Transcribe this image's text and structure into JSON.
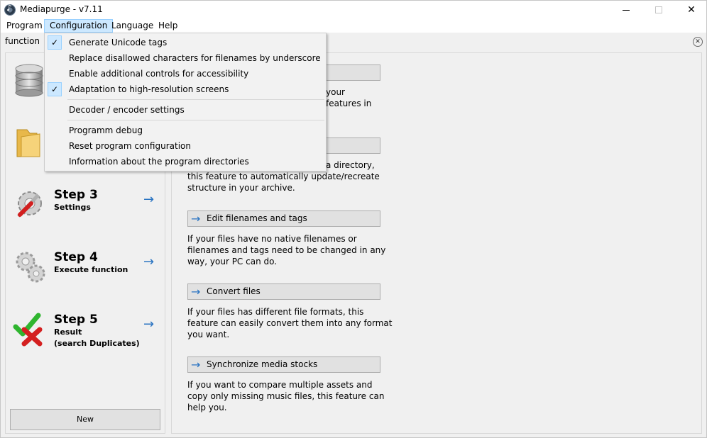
{
  "window": {
    "title": "Mediapurge - v7.11"
  },
  "menubar": {
    "items": [
      {
        "label": "Program"
      },
      {
        "label": "Configuration"
      },
      {
        "label": "Language"
      },
      {
        "label": "Help"
      }
    ]
  },
  "config_menu": {
    "items": [
      {
        "label": "Generate Unicode tags",
        "checked": true
      },
      {
        "label": "Replace disallowed characters for filenames by underscore",
        "checked": false
      },
      {
        "label": "Enable additional controls for accessibility",
        "checked": false
      },
      {
        "label": "Adaptation to high-resolution screens",
        "checked": true
      },
      {
        "label": "Decoder / encoder settings",
        "checked": false
      },
      {
        "label": "Programm debug",
        "checked": false
      },
      {
        "label": "Reset program configuration",
        "checked": false
      },
      {
        "label": "Information about the program directories",
        "checked": false
      }
    ],
    "check_glyph": "✓"
  },
  "tab": {
    "label": "function"
  },
  "steps": [
    {
      "title": "Step 3",
      "subtitle": "Settings"
    },
    {
      "title": "Step 4",
      "subtitle": "Execute function"
    },
    {
      "title": "Step 5",
      "subtitle": "Result\n(search Duplicates)"
    }
  ],
  "left": {
    "new_label": "New"
  },
  "features": {
    "partial1_lines": [
      "your",
      "features in"
    ],
    "partial2_lines": [
      "a directory,"
    ],
    "partial2_desc": "this feature to automatically update/recreate structure in your archive.",
    "items": [
      {
        "label": "Edit filenames and tags",
        "desc": "If your files have no native filenames or filenames and tags need to be changed in any way, your PC can do."
      },
      {
        "label": "Convert files",
        "desc": "If your files has different file formats, this feature can easily convert them into any format you want."
      },
      {
        "label": "Synchronize media stocks",
        "desc": "If you want to compare multiple assets and copy only missing music files, this feature can help you."
      }
    ]
  },
  "colors": {
    "accent": "#2a74c2",
    "menu_highlight": "#cce8ff"
  }
}
